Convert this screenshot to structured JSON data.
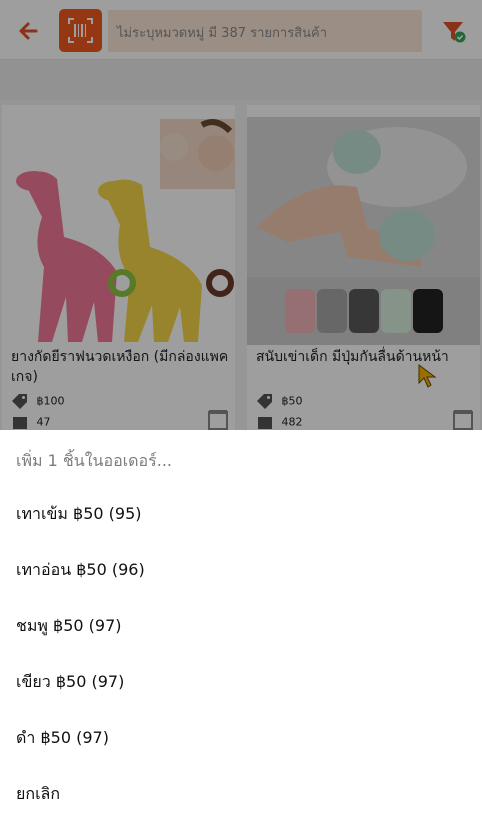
{
  "topbar": {
    "search_placeholder": "ไม่ระบุหมวดหมู่ มี 387 รายการสินค้า",
    "back_icon": "arrow-left-icon",
    "scan_icon": "barcode-scan-icon",
    "filter_icon": "filter-check-icon",
    "accent_color": "#ef5a1e"
  },
  "products": [
    {
      "title": "ยางกัดยีราฟนวดเหงือก (มีกล่องแพคเกจ)",
      "price": "฿100",
      "stock": "47"
    },
    {
      "title": "สนับเข่าเด็ก มีปุ่มกันลื่นด้านหน้า",
      "price": "฿50",
      "stock": "482"
    }
  ],
  "sheet": {
    "title": "เพิ่ม 1 ชิ้นในออเดอร์...",
    "options": [
      "เทาเข้ม ฿50 (95)",
      "เทาอ่อน ฿50 (96)",
      "ชมพู ฿50 (97)",
      "เขียว ฿50 (97)",
      "ดำ ฿50 (97)"
    ],
    "cancel": "ยกเลิก"
  }
}
